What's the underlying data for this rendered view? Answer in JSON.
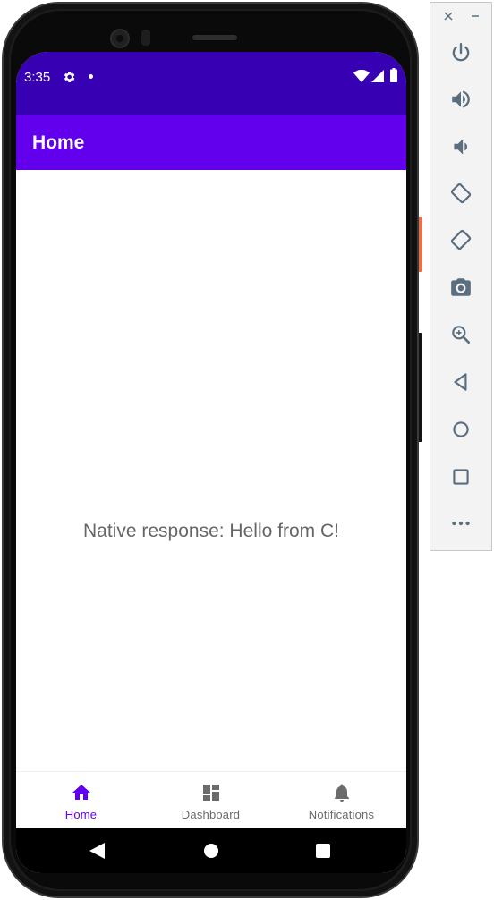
{
  "status_bar": {
    "time": "3:35",
    "background": "#3700b3"
  },
  "app_bar": {
    "title": "Home",
    "background": "#6200ee"
  },
  "content": {
    "message": "Native response: Hello from C!"
  },
  "bottom_nav": {
    "items": [
      {
        "label": "Home",
        "icon": "home-icon",
        "active": true
      },
      {
        "label": "Dashboard",
        "icon": "dashboard-icon",
        "active": false
      },
      {
        "label": "Notifications",
        "icon": "bell-icon",
        "active": false
      }
    ],
    "active_color": "#6200ee",
    "inactive_color": "#6b6b6b"
  },
  "system_nav": {
    "buttons": [
      "back-icon",
      "home-circle-icon",
      "recents-icon"
    ]
  },
  "emulator_toolbar": {
    "window_controls": [
      "close-icon",
      "minimize-icon"
    ],
    "buttons": [
      "power-icon",
      "volume-up-icon",
      "volume-down-icon",
      "rotate-left-icon",
      "rotate-right-icon",
      "camera-icon",
      "zoom-icon",
      "back-icon",
      "home-icon",
      "overview-icon",
      "more-icon"
    ],
    "icon_color": "#5a6e7f"
  }
}
